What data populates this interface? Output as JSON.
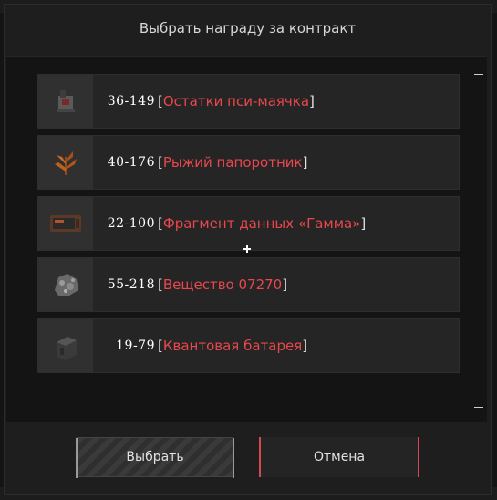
{
  "dialog": {
    "title": "Выбрать награду за контракт"
  },
  "rewards": [
    {
      "count": "36-149",
      "name": "Остатки пси-маячка",
      "icon": "psi-beacon-icon"
    },
    {
      "count": "40-176",
      "name": "Рыжий папоротник",
      "icon": "fern-icon"
    },
    {
      "count": "22-100",
      "name": "Фрагмент данных «Гамма»",
      "icon": "data-fragment-icon"
    },
    {
      "count": "55-218",
      "name": "Вещество 07270",
      "icon": "substance-icon"
    },
    {
      "count": "19-79",
      "name": "Квантовая батарея",
      "icon": "battery-icon"
    }
  ],
  "buttons": {
    "select_label": "Выбрать",
    "cancel_label": "Отмена"
  },
  "colors": {
    "accent": "#e8474d",
    "background": "#141414",
    "panel": "#1e1e1e"
  }
}
